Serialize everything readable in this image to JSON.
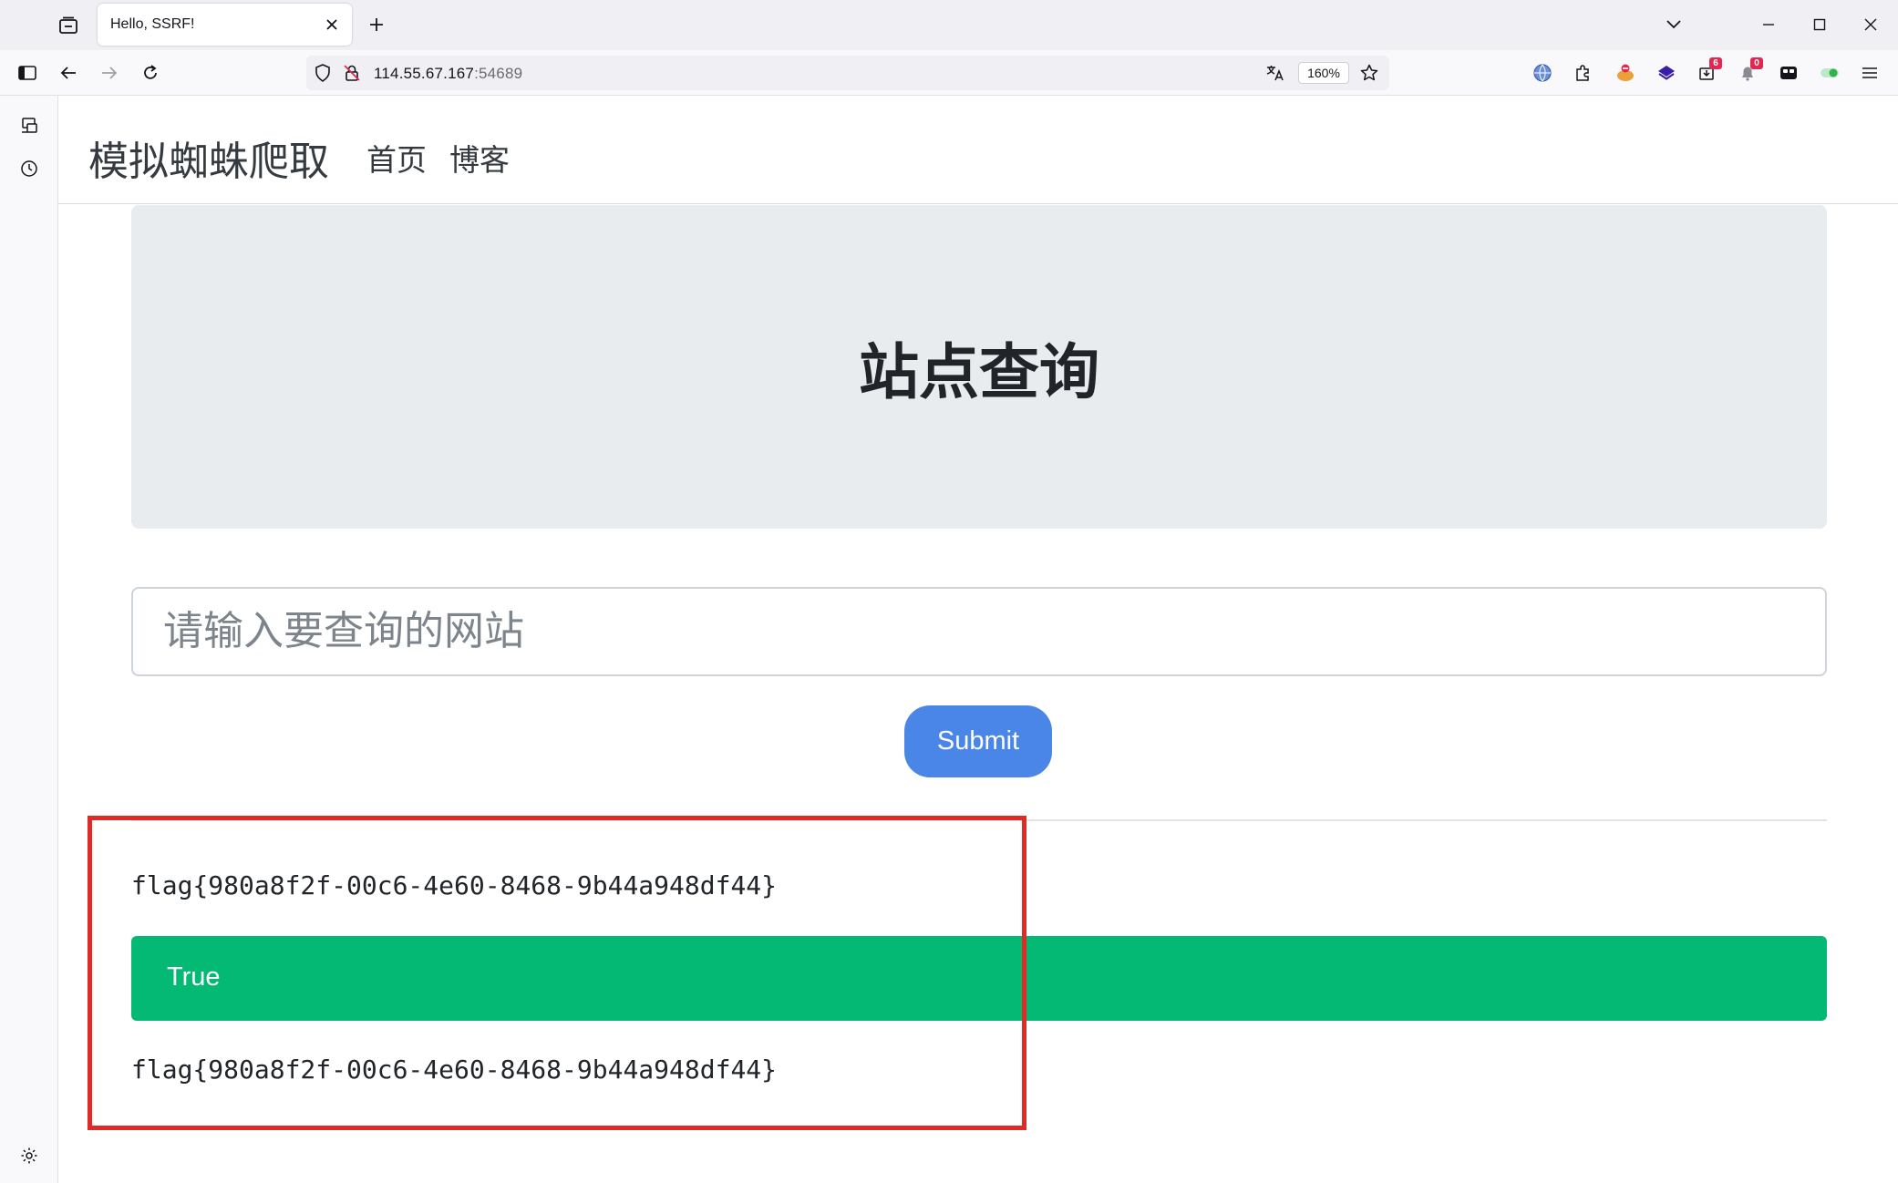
{
  "browser": {
    "tab_title": "Hello, SSRF!",
    "url_host": "114.55.67.167",
    "url_port": ":54689",
    "zoom": "160%",
    "extension_badges": [
      "6",
      "0"
    ]
  },
  "site": {
    "brand": "模拟蜘蛛爬取",
    "nav_links": [
      "首页",
      "博客"
    ],
    "jumbotron_title": "站点查询",
    "input_placeholder": "请输入要查询的网站",
    "submit_label": "Submit",
    "result_text_1": "flag{980a8f2f-00c6-4e60-8468-9b44a948df44}",
    "alert_text": "True",
    "result_text_2": "flag{980a8f2f-00c6-4e60-8468-9b44a948df44}"
  },
  "colors": {
    "primary": "#4a86e8",
    "success": "#04b974",
    "jumbotron_bg": "#e9ecef",
    "annotation": "#e02a25"
  },
  "icons": [
    "tab-list-icon",
    "close-icon",
    "plus-icon",
    "chevron-down-icon",
    "minimize-icon",
    "maximize-icon",
    "sidebar-toggle-icon",
    "back-arrow-icon",
    "forward-arrow-icon",
    "reload-icon",
    "shield-icon",
    "insecure-lock-icon",
    "translate-icon",
    "star-icon",
    "menu-icon",
    "history-icon",
    "settings-icon"
  ]
}
